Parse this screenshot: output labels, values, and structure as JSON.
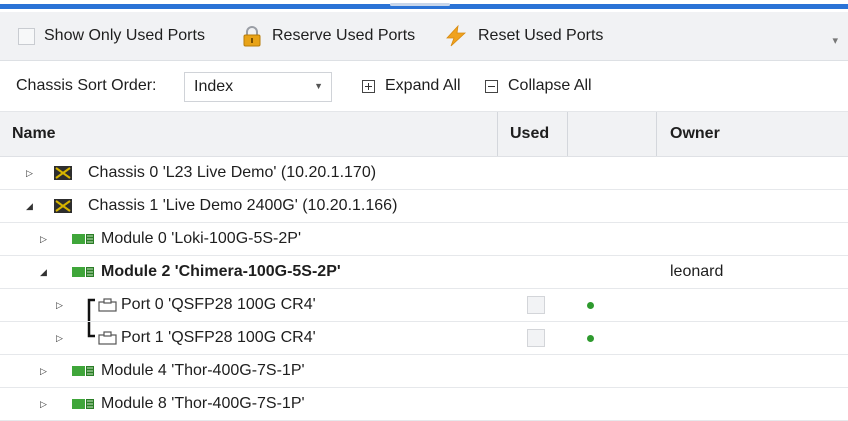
{
  "toolbar": {
    "show_only_used_label": "Show Only Used Ports",
    "reserve_label": "Reserve Used Ports",
    "reset_label": "Reset Used Ports"
  },
  "options": {
    "sort_label": "Chassis Sort Order:",
    "sort_value": "Index",
    "expand_all_label": "Expand All",
    "collapse_all_label": "Collapse All"
  },
  "columns": {
    "name": "Name",
    "used": "Used",
    "status": "",
    "owner": "Owner"
  },
  "rows": [
    {
      "type": "chassis",
      "expanded": false,
      "label": "Chassis 0 'L23 Live Demo' (10.20.1.170)",
      "owner": ""
    },
    {
      "type": "chassis",
      "expanded": true,
      "label": "Chassis 1 'Live Demo 2400G' (10.20.1.166)",
      "owner": ""
    },
    {
      "type": "module",
      "expanded": false,
      "label": "Module 0 'Loki-100G-5S-2P'",
      "owner": ""
    },
    {
      "type": "module",
      "expanded": true,
      "bold": true,
      "label": "Module 2 'Chimera-100G-5S-2P'",
      "owner": "leonard"
    },
    {
      "type": "port",
      "expanded": false,
      "label": "Port 0 'QSFP28 100G CR4'",
      "used": false,
      "status": "green",
      "owner": ""
    },
    {
      "type": "port",
      "expanded": false,
      "label": "Port 1 'QSFP28 100G CR4'",
      "used": false,
      "status": "green",
      "owner": ""
    },
    {
      "type": "module",
      "expanded": false,
      "label": "Module 4 'Thor-400G-7S-1P'",
      "owner": ""
    },
    {
      "type": "module",
      "expanded": false,
      "label": "Module 8 'Thor-400G-7S-1P'",
      "owner": ""
    }
  ],
  "colors": {
    "accent": "#2b73d6",
    "status_green": "#2e9a2e",
    "module_green": "#3fa63a",
    "lock_orange": "#e8a317",
    "reset_orange": "#f0a21e"
  },
  "icons": [
    "lock-icon",
    "lightning-icon",
    "plus-box-icon",
    "minus-box-icon",
    "chassis-icon",
    "module-icon",
    "port-icon",
    "expand-triangle-icon",
    "collapse-triangle-icon"
  ]
}
